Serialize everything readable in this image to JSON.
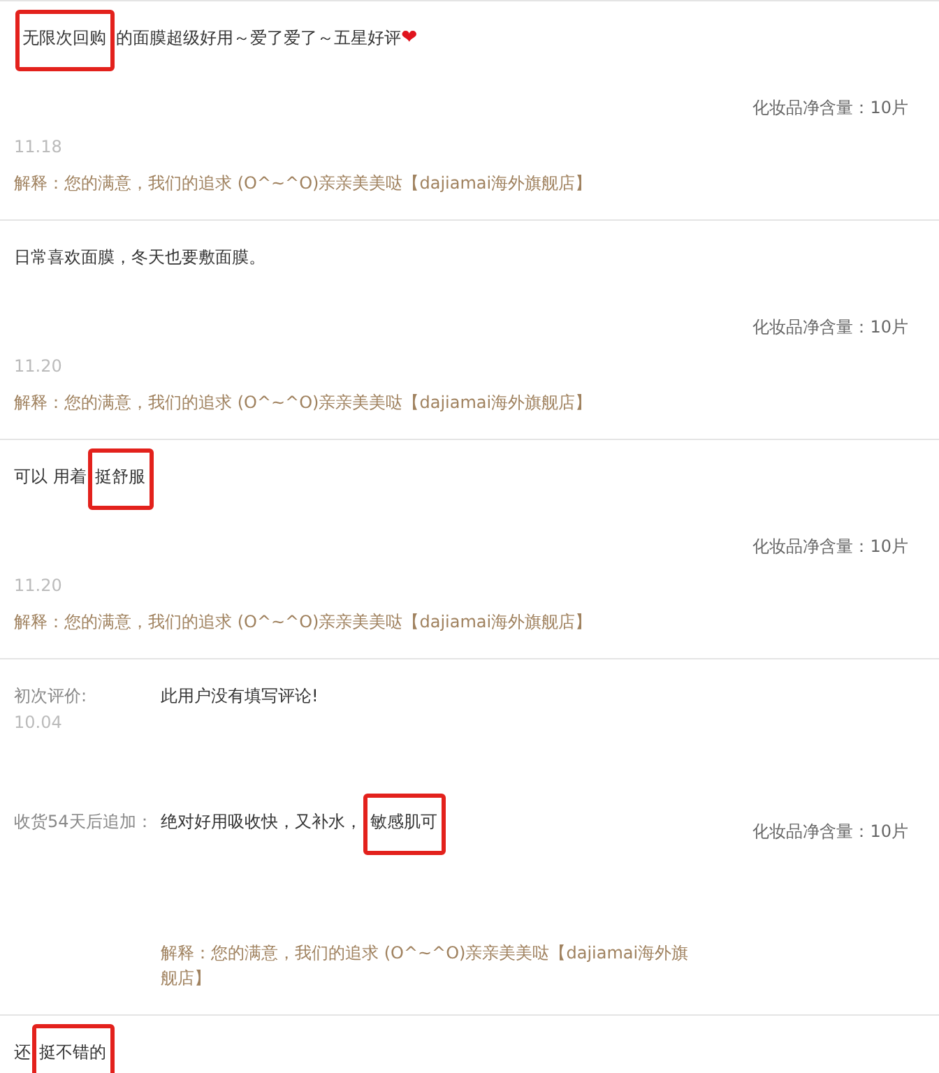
{
  "reviews": [
    {
      "kind": "simple",
      "text": [
        {
          "text": "无限次回购",
          "highlighted": true
        },
        {
          "text": "的面膜超级好用～爱了爱了～五星好评",
          "highlighted": false
        }
      ],
      "emoji": "❤",
      "spec": "化妆品净含量：10片",
      "date": "11.18",
      "reply": "解释：您的满意，我们的追求 (O^~^O)亲亲美美哒【dajiamai海外旗舰店】"
    },
    {
      "kind": "simple",
      "text": [
        {
          "text": "日常喜欢面膜，冬天也要敷面膜。",
          "highlighted": false
        }
      ],
      "spec": "化妆品净含量：10片",
      "date": "11.20",
      "reply": "解释：您的满意，我们的追求 (O^~^O)亲亲美美哒【dajiamai海外旗舰店】"
    },
    {
      "kind": "simple",
      "text": [
        {
          "text": "可以 用着",
          "highlighted": false
        },
        {
          "text": "挺舒服",
          "highlighted": true
        }
      ],
      "spec": "化妆品净含量：10片",
      "date": "11.20",
      "reply": "解释：您的满意，我们的追求 (O^~^O)亲亲美美哒【dajiamai海外旗舰店】"
    },
    {
      "kind": "appended",
      "initial": {
        "label": "初次评价:",
        "date": "10.04",
        "text": [
          {
            "text": "此用户没有填写评论!",
            "highlighted": false
          }
        ]
      },
      "append": {
        "label": "收货54天后追加：",
        "text": [
          {
            "text": "绝对好用吸收快，又补水，",
            "highlighted": false
          },
          {
            "text": "敏感肌可",
            "highlighted": true
          }
        ]
      },
      "spec": "化妆品净含量：10片",
      "reply": "解释：您的满意，我们的追求 (O^~^O)亲亲美美哒【dajiamai海外旗舰店】"
    },
    {
      "kind": "simple",
      "text": [
        {
          "text": "还",
          "highlighted": false
        },
        {
          "text": "挺不错的",
          "highlighted": true
        }
      ]
    }
  ]
}
